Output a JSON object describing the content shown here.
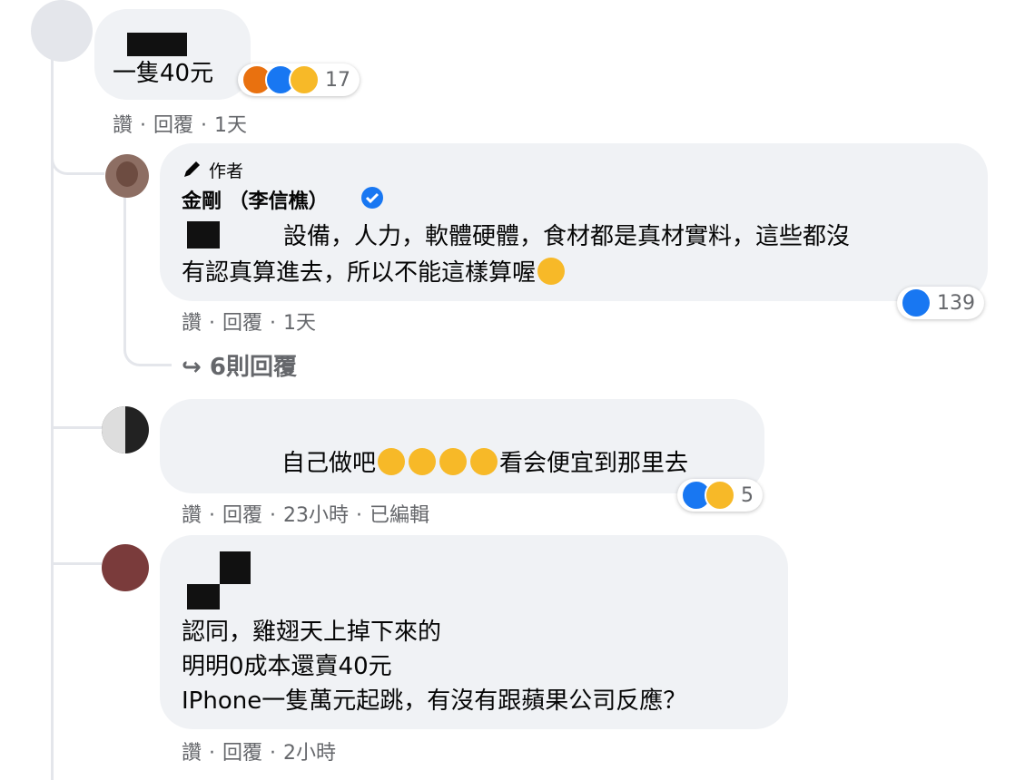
{
  "comments": [
    {
      "text": "一隻40元",
      "reactions": {
        "count": "17",
        "types": [
          "angry-icon",
          "like-icon",
          "haha-icon"
        ]
      },
      "actions": {
        "like": "讚",
        "reply": "回覆",
        "time": "1天"
      }
    },
    {
      "badge": "作者",
      "name": "金剛 （李信樵）",
      "text_line1": "設備，人力，軟體硬體，食材都是真材實料，這些都沒",
      "text_line2": "有認真算進去，所以不能這樣算喔",
      "reactions": {
        "count": "139",
        "types": [
          "like-icon"
        ]
      },
      "actions": {
        "like": "讚",
        "reply": "回覆",
        "time": "1天"
      },
      "more_replies": "6則回覆"
    },
    {
      "text_pre": "自己做吧",
      "text_post": "看会便宜到那里去",
      "reactions": {
        "count": "5",
        "types": [
          "like-icon",
          "haha-icon"
        ]
      },
      "actions": {
        "like": "讚",
        "reply": "回覆",
        "time": "23小時",
        "edited": "已編輯"
      }
    },
    {
      "line1": "認同，雞翅天上掉下來的",
      "line2": "明明0成本還賣40元",
      "line3": "IPhone一隻萬元起跳，有沒有跟蘋果公司反應？",
      "actions": {
        "like": "讚",
        "reply": "回覆",
        "time": "2小時"
      }
    }
  ],
  "colors": {
    "bubble": "#f0f2f5",
    "meta": "#65676b",
    "like": "#1877f2",
    "haha": "#f7b928"
  }
}
